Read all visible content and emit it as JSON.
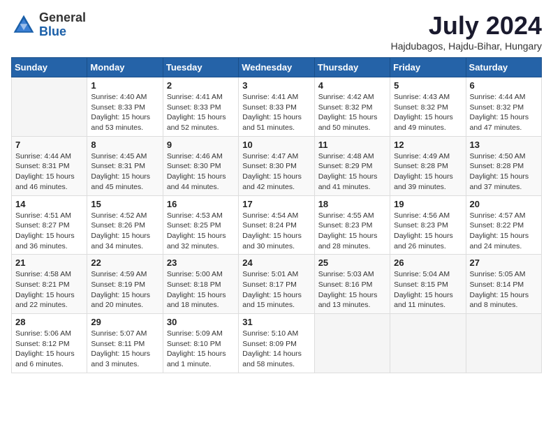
{
  "header": {
    "logo_general": "General",
    "logo_blue": "Blue",
    "title": "July 2024",
    "location": "Hajdubagos, Hajdu-Bihar, Hungary"
  },
  "calendar": {
    "days_of_week": [
      "Sunday",
      "Monday",
      "Tuesday",
      "Wednesday",
      "Thursday",
      "Friday",
      "Saturday"
    ],
    "weeks": [
      [
        {
          "day": "",
          "info": ""
        },
        {
          "day": "1",
          "info": "Sunrise: 4:40 AM\nSunset: 8:33 PM\nDaylight: 15 hours\nand 53 minutes."
        },
        {
          "day": "2",
          "info": "Sunrise: 4:41 AM\nSunset: 8:33 PM\nDaylight: 15 hours\nand 52 minutes."
        },
        {
          "day": "3",
          "info": "Sunrise: 4:41 AM\nSunset: 8:33 PM\nDaylight: 15 hours\nand 51 minutes."
        },
        {
          "day": "4",
          "info": "Sunrise: 4:42 AM\nSunset: 8:32 PM\nDaylight: 15 hours\nand 50 minutes."
        },
        {
          "day": "5",
          "info": "Sunrise: 4:43 AM\nSunset: 8:32 PM\nDaylight: 15 hours\nand 49 minutes."
        },
        {
          "day": "6",
          "info": "Sunrise: 4:44 AM\nSunset: 8:32 PM\nDaylight: 15 hours\nand 47 minutes."
        }
      ],
      [
        {
          "day": "7",
          "info": "Sunrise: 4:44 AM\nSunset: 8:31 PM\nDaylight: 15 hours\nand 46 minutes."
        },
        {
          "day": "8",
          "info": "Sunrise: 4:45 AM\nSunset: 8:31 PM\nDaylight: 15 hours\nand 45 minutes."
        },
        {
          "day": "9",
          "info": "Sunrise: 4:46 AM\nSunset: 8:30 PM\nDaylight: 15 hours\nand 44 minutes."
        },
        {
          "day": "10",
          "info": "Sunrise: 4:47 AM\nSunset: 8:30 PM\nDaylight: 15 hours\nand 42 minutes."
        },
        {
          "day": "11",
          "info": "Sunrise: 4:48 AM\nSunset: 8:29 PM\nDaylight: 15 hours\nand 41 minutes."
        },
        {
          "day": "12",
          "info": "Sunrise: 4:49 AM\nSunset: 8:28 PM\nDaylight: 15 hours\nand 39 minutes."
        },
        {
          "day": "13",
          "info": "Sunrise: 4:50 AM\nSunset: 8:28 PM\nDaylight: 15 hours\nand 37 minutes."
        }
      ],
      [
        {
          "day": "14",
          "info": "Sunrise: 4:51 AM\nSunset: 8:27 PM\nDaylight: 15 hours\nand 36 minutes."
        },
        {
          "day": "15",
          "info": "Sunrise: 4:52 AM\nSunset: 8:26 PM\nDaylight: 15 hours\nand 34 minutes."
        },
        {
          "day": "16",
          "info": "Sunrise: 4:53 AM\nSunset: 8:25 PM\nDaylight: 15 hours\nand 32 minutes."
        },
        {
          "day": "17",
          "info": "Sunrise: 4:54 AM\nSunset: 8:24 PM\nDaylight: 15 hours\nand 30 minutes."
        },
        {
          "day": "18",
          "info": "Sunrise: 4:55 AM\nSunset: 8:23 PM\nDaylight: 15 hours\nand 28 minutes."
        },
        {
          "day": "19",
          "info": "Sunrise: 4:56 AM\nSunset: 8:23 PM\nDaylight: 15 hours\nand 26 minutes."
        },
        {
          "day": "20",
          "info": "Sunrise: 4:57 AM\nSunset: 8:22 PM\nDaylight: 15 hours\nand 24 minutes."
        }
      ],
      [
        {
          "day": "21",
          "info": "Sunrise: 4:58 AM\nSunset: 8:21 PM\nDaylight: 15 hours\nand 22 minutes."
        },
        {
          "day": "22",
          "info": "Sunrise: 4:59 AM\nSunset: 8:19 PM\nDaylight: 15 hours\nand 20 minutes."
        },
        {
          "day": "23",
          "info": "Sunrise: 5:00 AM\nSunset: 8:18 PM\nDaylight: 15 hours\nand 18 minutes."
        },
        {
          "day": "24",
          "info": "Sunrise: 5:01 AM\nSunset: 8:17 PM\nDaylight: 15 hours\nand 15 minutes."
        },
        {
          "day": "25",
          "info": "Sunrise: 5:03 AM\nSunset: 8:16 PM\nDaylight: 15 hours\nand 13 minutes."
        },
        {
          "day": "26",
          "info": "Sunrise: 5:04 AM\nSunset: 8:15 PM\nDaylight: 15 hours\nand 11 minutes."
        },
        {
          "day": "27",
          "info": "Sunrise: 5:05 AM\nSunset: 8:14 PM\nDaylight: 15 hours\nand 8 minutes."
        }
      ],
      [
        {
          "day": "28",
          "info": "Sunrise: 5:06 AM\nSunset: 8:12 PM\nDaylight: 15 hours\nand 6 minutes."
        },
        {
          "day": "29",
          "info": "Sunrise: 5:07 AM\nSunset: 8:11 PM\nDaylight: 15 hours\nand 3 minutes."
        },
        {
          "day": "30",
          "info": "Sunrise: 5:09 AM\nSunset: 8:10 PM\nDaylight: 15 hours\nand 1 minute."
        },
        {
          "day": "31",
          "info": "Sunrise: 5:10 AM\nSunset: 8:09 PM\nDaylight: 14 hours\nand 58 minutes."
        },
        {
          "day": "",
          "info": ""
        },
        {
          "day": "",
          "info": ""
        },
        {
          "day": "",
          "info": ""
        }
      ]
    ]
  }
}
